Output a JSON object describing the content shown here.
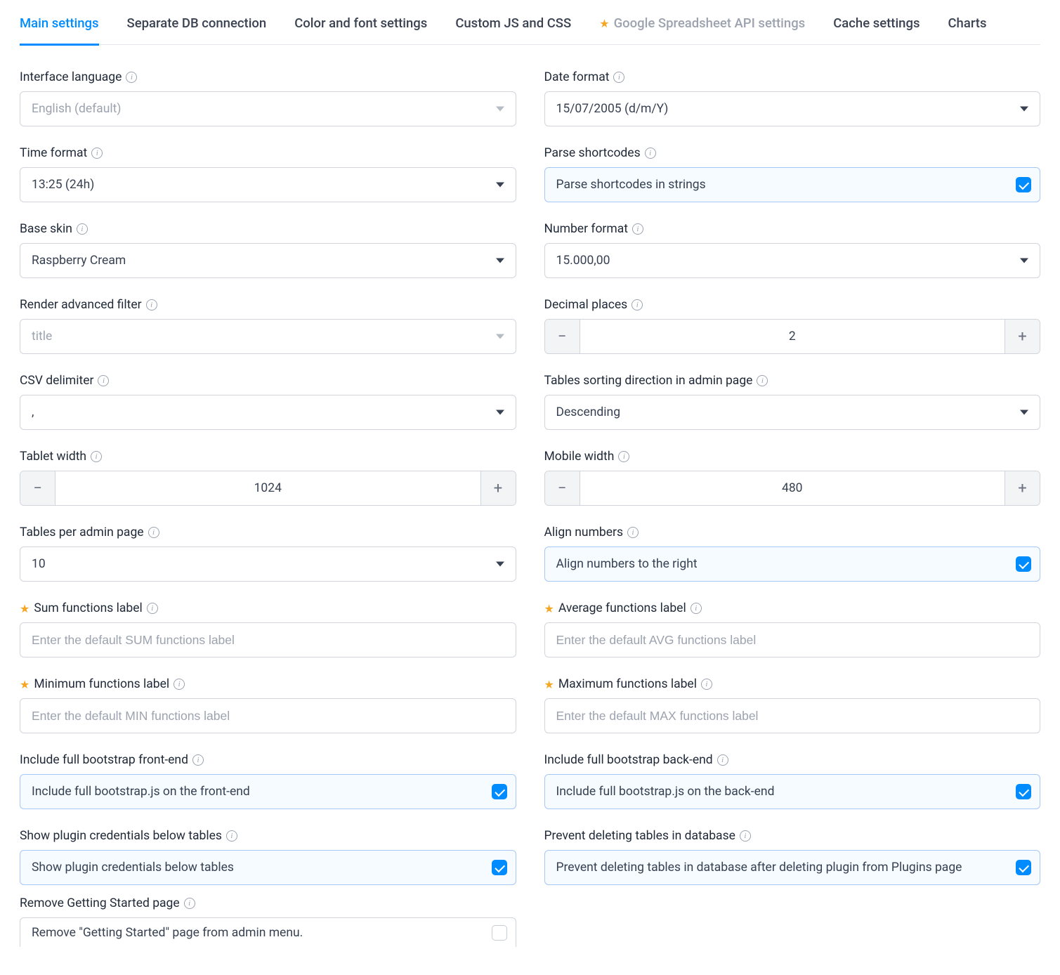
{
  "tabs": [
    {
      "label": "Main settings",
      "active": true
    },
    {
      "label": "Separate DB connection"
    },
    {
      "label": "Color and font settings"
    },
    {
      "label": "Custom JS and CSS"
    },
    {
      "label": "Google Spreadsheet API settings",
      "star": true,
      "muted": true
    },
    {
      "label": "Cache settings"
    },
    {
      "label": "Charts"
    }
  ],
  "left": {
    "interface_language": {
      "label": "Interface language",
      "value": "English (default)",
      "placeholder": true
    },
    "time_format": {
      "label": "Time format",
      "value": "13:25 (24h)"
    },
    "base_skin": {
      "label": "Base skin",
      "value": "Raspberry Cream"
    },
    "render_advanced_filter": {
      "label": "Render advanced filter",
      "value": "title",
      "placeholder": true
    },
    "csv_delimiter": {
      "label": "CSV delimiter",
      "value": ","
    },
    "tablet_width": {
      "label": "Tablet width",
      "value": "1024"
    },
    "tables_per_admin": {
      "label": "Tables per admin page",
      "value": "10"
    },
    "sum_label": {
      "label": "Sum functions label",
      "placeholder": "Enter the default SUM functions label"
    },
    "min_label": {
      "label": "Minimum functions label",
      "placeholder": "Enter the default MIN functions label"
    },
    "bootstrap_front": {
      "label": "Include full bootstrap front-end",
      "text": "Include full bootstrap.js on the front-end",
      "checked": true
    },
    "show_credentials": {
      "label": "Show plugin credentials below tables",
      "text": "Show plugin credentials below tables",
      "checked": true
    },
    "remove_getting_started": {
      "label": "Remove Getting Started page",
      "text": "Remove \"Getting Started\" page from admin menu.",
      "checked": false
    }
  },
  "right": {
    "date_format": {
      "label": "Date format",
      "value": "15/07/2005 (d/m/Y)"
    },
    "parse_shortcodes": {
      "label": "Parse shortcodes",
      "text": "Parse shortcodes in strings",
      "checked": true
    },
    "number_format": {
      "label": "Number format",
      "value": "15.000,00"
    },
    "decimal_places": {
      "label": "Decimal places",
      "value": "2"
    },
    "sorting_direction": {
      "label": "Tables sorting direction in admin page",
      "value": "Descending"
    },
    "mobile_width": {
      "label": "Mobile width",
      "value": "480"
    },
    "align_numbers": {
      "label": "Align numbers",
      "text": "Align numbers to the right",
      "checked": true
    },
    "avg_label": {
      "label": "Average functions label",
      "placeholder": "Enter the default AVG functions label"
    },
    "max_label": {
      "label": "Maximum functions label",
      "placeholder": "Enter the default MAX functions label"
    },
    "bootstrap_back": {
      "label": "Include full bootstrap back-end",
      "text": "Include full bootstrap.js on the back-end",
      "checked": true
    },
    "prevent_delete": {
      "label": "Prevent deleting tables in database",
      "text": "Prevent deleting tables in database after deleting plugin from Plugins page",
      "checked": true
    }
  }
}
